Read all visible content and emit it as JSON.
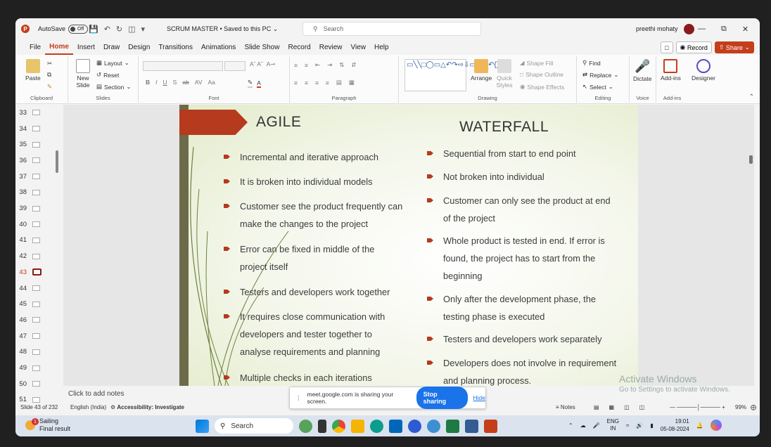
{
  "titlebar": {
    "autosave_label": "AutoSave",
    "autosave_state": "Off",
    "doc_title": "SCRUM MASTER • Saved to this PC",
    "search_placeholder": "Search",
    "user_name": "preethi mohaty"
  },
  "tabs": [
    "File",
    "Home",
    "Insert",
    "Draw",
    "Design",
    "Transitions",
    "Animations",
    "Slide Show",
    "Record",
    "Review",
    "View",
    "Help"
  ],
  "active_tab": "Home",
  "tab_actions": {
    "record": "Record",
    "share": "Share"
  },
  "ribbon": {
    "clipboard": {
      "paste": "Paste",
      "label": "Clipboard"
    },
    "slides": {
      "new_slide": "New Slide",
      "layout": "Layout",
      "reset": "Reset",
      "section": "Section",
      "label": "Slides"
    },
    "font": {
      "label": "Font"
    },
    "paragraph": {
      "label": "Paragraph"
    },
    "drawing": {
      "arrange": "Arrange",
      "quick_styles": "Quick Styles",
      "shape_fill": "Shape Fill",
      "shape_outline": "Shape Outline",
      "shape_effects": "Shape Effects",
      "label": "Drawing"
    },
    "editing": {
      "find": "Find",
      "replace": "Replace",
      "select": "Select",
      "label": "Editing"
    },
    "voice": {
      "dictate": "Dictate",
      "label": "Voice"
    },
    "addins": {
      "addins": "Add-ins",
      "designer": "Designer",
      "label": "Add-ins"
    }
  },
  "slide_thumbs": [
    "33",
    "34",
    "35",
    "36",
    "37",
    "38",
    "39",
    "40",
    "41",
    "42",
    "43",
    "44",
    "45",
    "46",
    "47",
    "48",
    "49",
    "50",
    "51"
  ],
  "selected_slide": "43",
  "slide": {
    "left_heading": "AGILE",
    "right_heading": "WATERFALL",
    "agile_points": [
      "Incremental and iterative approach",
      "It is broken into individual models",
      "Customer see the product frequently can make the changes to the project",
      "Error can be fixed   in middle of the project itself",
      "Testers and developers work together",
      "It requires close communication with developers and tester together to analyse requirements and planning",
      "Multiple checks in each iterations"
    ],
    "waterfall_points": [
      "Sequential from start to end point",
      "Not broken into individual",
      "Customer can only see the product at end of the project",
      " Whole product is tested in end.  If error is found, the project has to start from the beginning",
      "Only after the development phase, the testing phase is executed",
      "Testers and developers work separately",
      "Developers does not involve in requirement and planning process."
    ]
  },
  "notes_placeholder": "Click to add notes",
  "watermark": {
    "line1": "Activate Windows",
    "line2": "Go to Settings to activate Windows."
  },
  "share_bar": {
    "message": "meet.google.com is sharing your screen.",
    "stop": "Stop sharing",
    "hide": "Hide"
  },
  "status": {
    "slide_of": "Slide 43 of 232",
    "language": "English (India)",
    "accessibility": "Accessibility: Investigate",
    "notes": "Notes",
    "zoom": "99%"
  },
  "taskbar": {
    "weather_title": "Sailing",
    "weather_sub": "Final result",
    "notification_count": "1",
    "search": "Search",
    "lang_top": "ENG",
    "lang_bottom": "IN",
    "time": "19:01",
    "date": "05-08-2024"
  },
  "colors": {
    "accent": "#c43e1c",
    "slide_arrow": "#b53a1e",
    "share_blue": "#1a73e8"
  }
}
